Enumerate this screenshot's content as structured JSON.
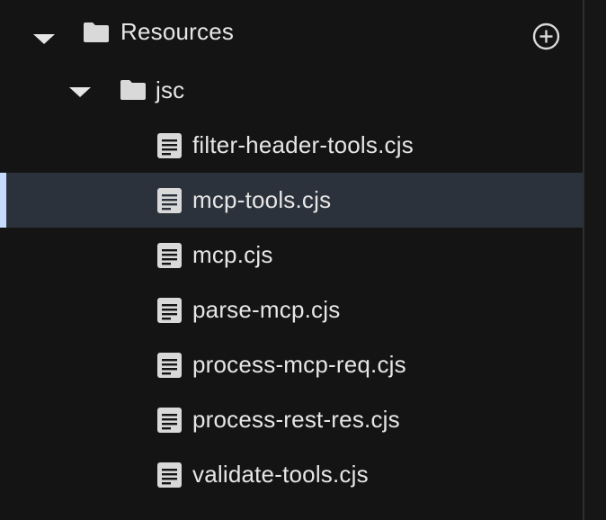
{
  "tree": {
    "root_folder": {
      "label": "Resources",
      "expanded": true,
      "icon": "folder-icon",
      "add_action_icon": "add-circle-icon",
      "child_folder": {
        "label": "jsc",
        "expanded": true,
        "icon": "folder-icon",
        "files": [
          {
            "label": "filter-header-tools.cjs",
            "icon": "file-text-icon",
            "selected": false
          },
          {
            "label": "mcp-tools.cjs",
            "icon": "file-text-icon",
            "selected": true
          },
          {
            "label": "mcp.cjs",
            "icon": "file-text-icon",
            "selected": false
          },
          {
            "label": "parse-mcp.cjs",
            "icon": "file-text-icon",
            "selected": false
          },
          {
            "label": "process-mcp-req.cjs",
            "icon": "file-text-icon",
            "selected": false
          },
          {
            "label": "process-rest-res.cjs",
            "icon": "file-text-icon",
            "selected": false
          },
          {
            "label": "validate-tools.cjs",
            "icon": "file-text-icon",
            "selected": false
          }
        ]
      }
    }
  },
  "colors": {
    "background": "#141414",
    "text": "#e6e6e6",
    "selected_row": "#2c323c",
    "selected_accent": "#c6dcff",
    "icon": "#d9d9d9"
  }
}
